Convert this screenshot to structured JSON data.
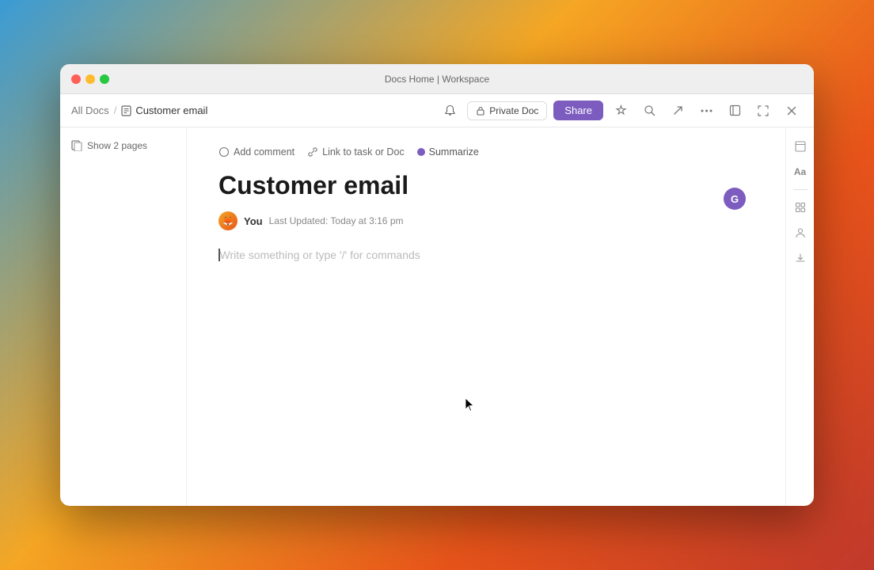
{
  "titlebar": {
    "title": "Docs Home | Workspace"
  },
  "toolbar": {
    "breadcrumb_home": "All Docs",
    "breadcrumb_separator": "/",
    "breadcrumb_current": "Customer email",
    "private_doc_label": "Private Doc",
    "share_label": "Share"
  },
  "left_sidebar": {
    "show_pages_label": "Show 2 pages"
  },
  "doc_toolbar": {
    "add_comment_label": "Add comment",
    "link_task_label": "Link to task or Doc",
    "summarize_label": "Summarize"
  },
  "document": {
    "title": "Customer email",
    "author": "You",
    "last_updated": "Last Updated: Today at 3:16 pm",
    "editor_placeholder": "Write something or type '/' for commands"
  },
  "right_sidebar": {
    "font_icon": "Aa",
    "layout_icon": "⊞",
    "people_icon": "👤",
    "download_icon": "↓"
  },
  "icons": {
    "close": "●",
    "minimize": "●",
    "maximize": "●",
    "doc_small": "📄",
    "bell": "🔔",
    "search": "⌕",
    "export": "↗",
    "more": "···",
    "collapse": "⊠",
    "fullscreen": "⛶",
    "close_win": "✕",
    "lock": "🔒",
    "star": "☆",
    "comment_icon": "○",
    "link_icon": "⛓",
    "ai_icon": "G"
  },
  "colors": {
    "share_bg": "#7c5cbf",
    "ai_dot": "#7c5cbf"
  }
}
